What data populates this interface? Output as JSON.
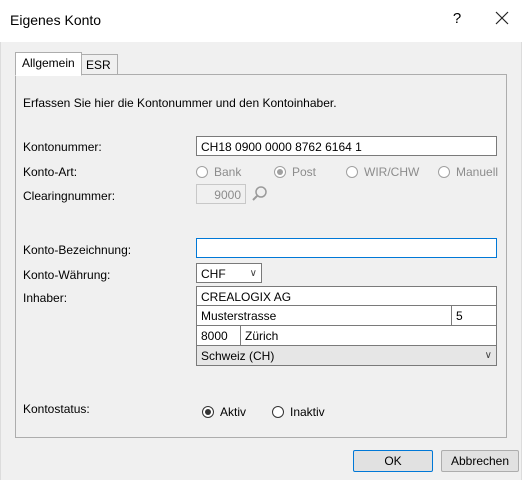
{
  "window": {
    "title": "Eigenes Konto",
    "help": "?",
    "close": "X"
  },
  "tabs": [
    {
      "label": "Allgemein"
    },
    {
      "label": "ESR"
    }
  ],
  "intro": "Erfassen Sie hier die Kontonummer und den Kontoinhaber.",
  "fields": {
    "kontonummer_label": "Kontonummer:",
    "kontonummer_value": "CH18 0900 0000 8762 6164 1",
    "kontoart_label": "Konto-Art:",
    "kontoart_options": [
      {
        "label": "Bank",
        "selected": false
      },
      {
        "label": "Post",
        "selected": true
      },
      {
        "label": "WIR/CHW",
        "selected": false
      },
      {
        "label": "Manuell",
        "selected": false
      }
    ],
    "clearing_label": "Clearingnummer:",
    "clearing_value": "9000",
    "bezeichnung_label": "Konto-Bezeichnung:",
    "bezeichnung_value": "",
    "waehrung_label": "Konto-Währung:",
    "waehrung_value": "CHF",
    "inhaber_label": "Inhaber:",
    "inhaber_name": "CREALOGIX AG",
    "inhaber_strasse": "Musterstrasse",
    "inhaber_hausnr": "5",
    "inhaber_plz": "8000",
    "inhaber_ort": "Zürich",
    "inhaber_land": "Schweiz (CH)",
    "status_label": "Kontostatus:",
    "status_options": [
      {
        "label": "Aktiv",
        "selected": true
      },
      {
        "label": "Inaktiv",
        "selected": false
      }
    ]
  },
  "buttons": {
    "ok": "OK",
    "cancel": "Abbrechen"
  },
  "icons": {
    "search": "magnifier-icon",
    "dropdown": "chevron-down-icon"
  }
}
